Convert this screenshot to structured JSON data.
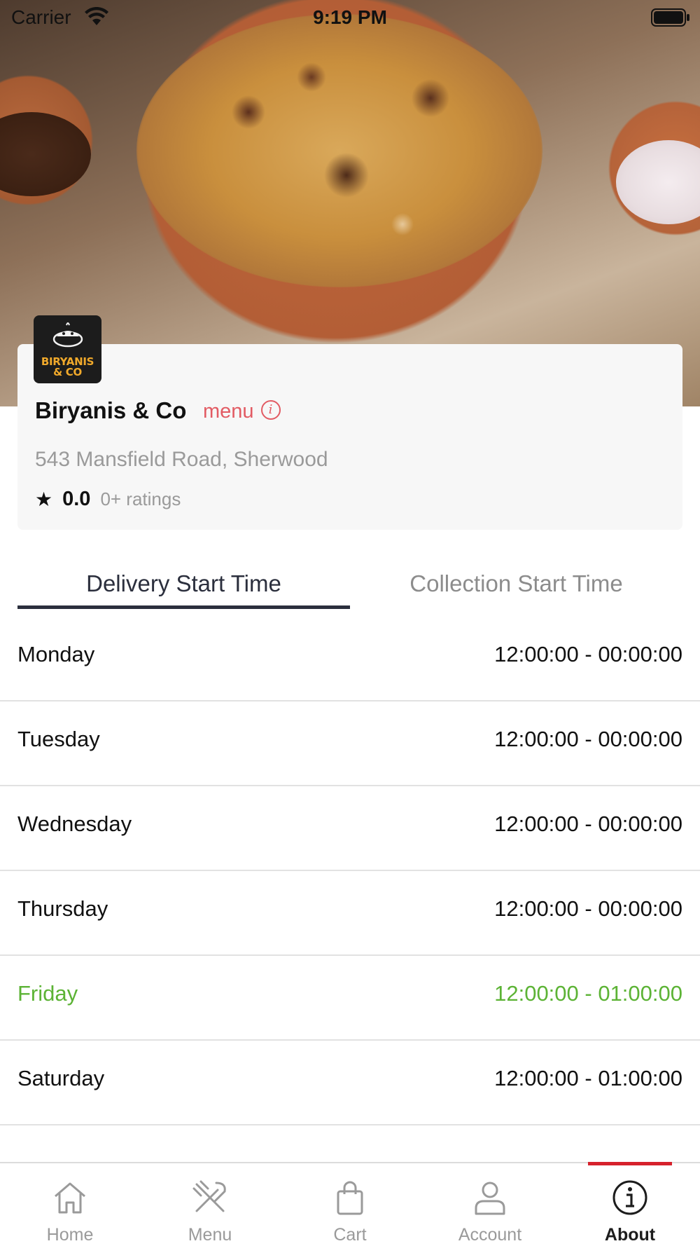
{
  "status_bar": {
    "carrier": "Carrier",
    "time": "9:19 PM"
  },
  "restaurant": {
    "logo_text_line1": "BIRYANIS",
    "logo_text_line2": "& CO",
    "name": "Biryanis & Co",
    "menu_link": "menu",
    "address": "543 Mansfield Road, Sherwood",
    "rating": "0.0",
    "rating_count": "0+ ratings"
  },
  "tabs": {
    "delivery": "Delivery Start Time",
    "collection": "Collection Start Time",
    "active": "delivery"
  },
  "hours": [
    {
      "day": "Monday",
      "time": "12:00:00 - 00:00:00",
      "today": false
    },
    {
      "day": "Tuesday",
      "time": "12:00:00 - 00:00:00",
      "today": false
    },
    {
      "day": "Wednesday",
      "time": "12:00:00 - 00:00:00",
      "today": false
    },
    {
      "day": "Thursday",
      "time": "12:00:00 - 00:00:00",
      "today": false
    },
    {
      "day": "Friday",
      "time": "12:00:00 - 01:00:00",
      "today": true
    },
    {
      "day": "Saturday",
      "time": "12:00:00 - 01:00:00",
      "today": false
    }
  ],
  "bottom_nav": [
    {
      "label": "Home",
      "icon": "home-icon"
    },
    {
      "label": "Menu",
      "icon": "fork-knife-icon"
    },
    {
      "label": "Cart",
      "icon": "shopping-bag-icon"
    },
    {
      "label": "Account",
      "icon": "user-icon"
    },
    {
      "label": "About",
      "icon": "info-icon"
    }
  ],
  "colors": {
    "accent_red": "#e25b63",
    "today_green": "#5cb335",
    "active_tab": "#2b2f3d",
    "nav_indicator": "#d6212c"
  }
}
